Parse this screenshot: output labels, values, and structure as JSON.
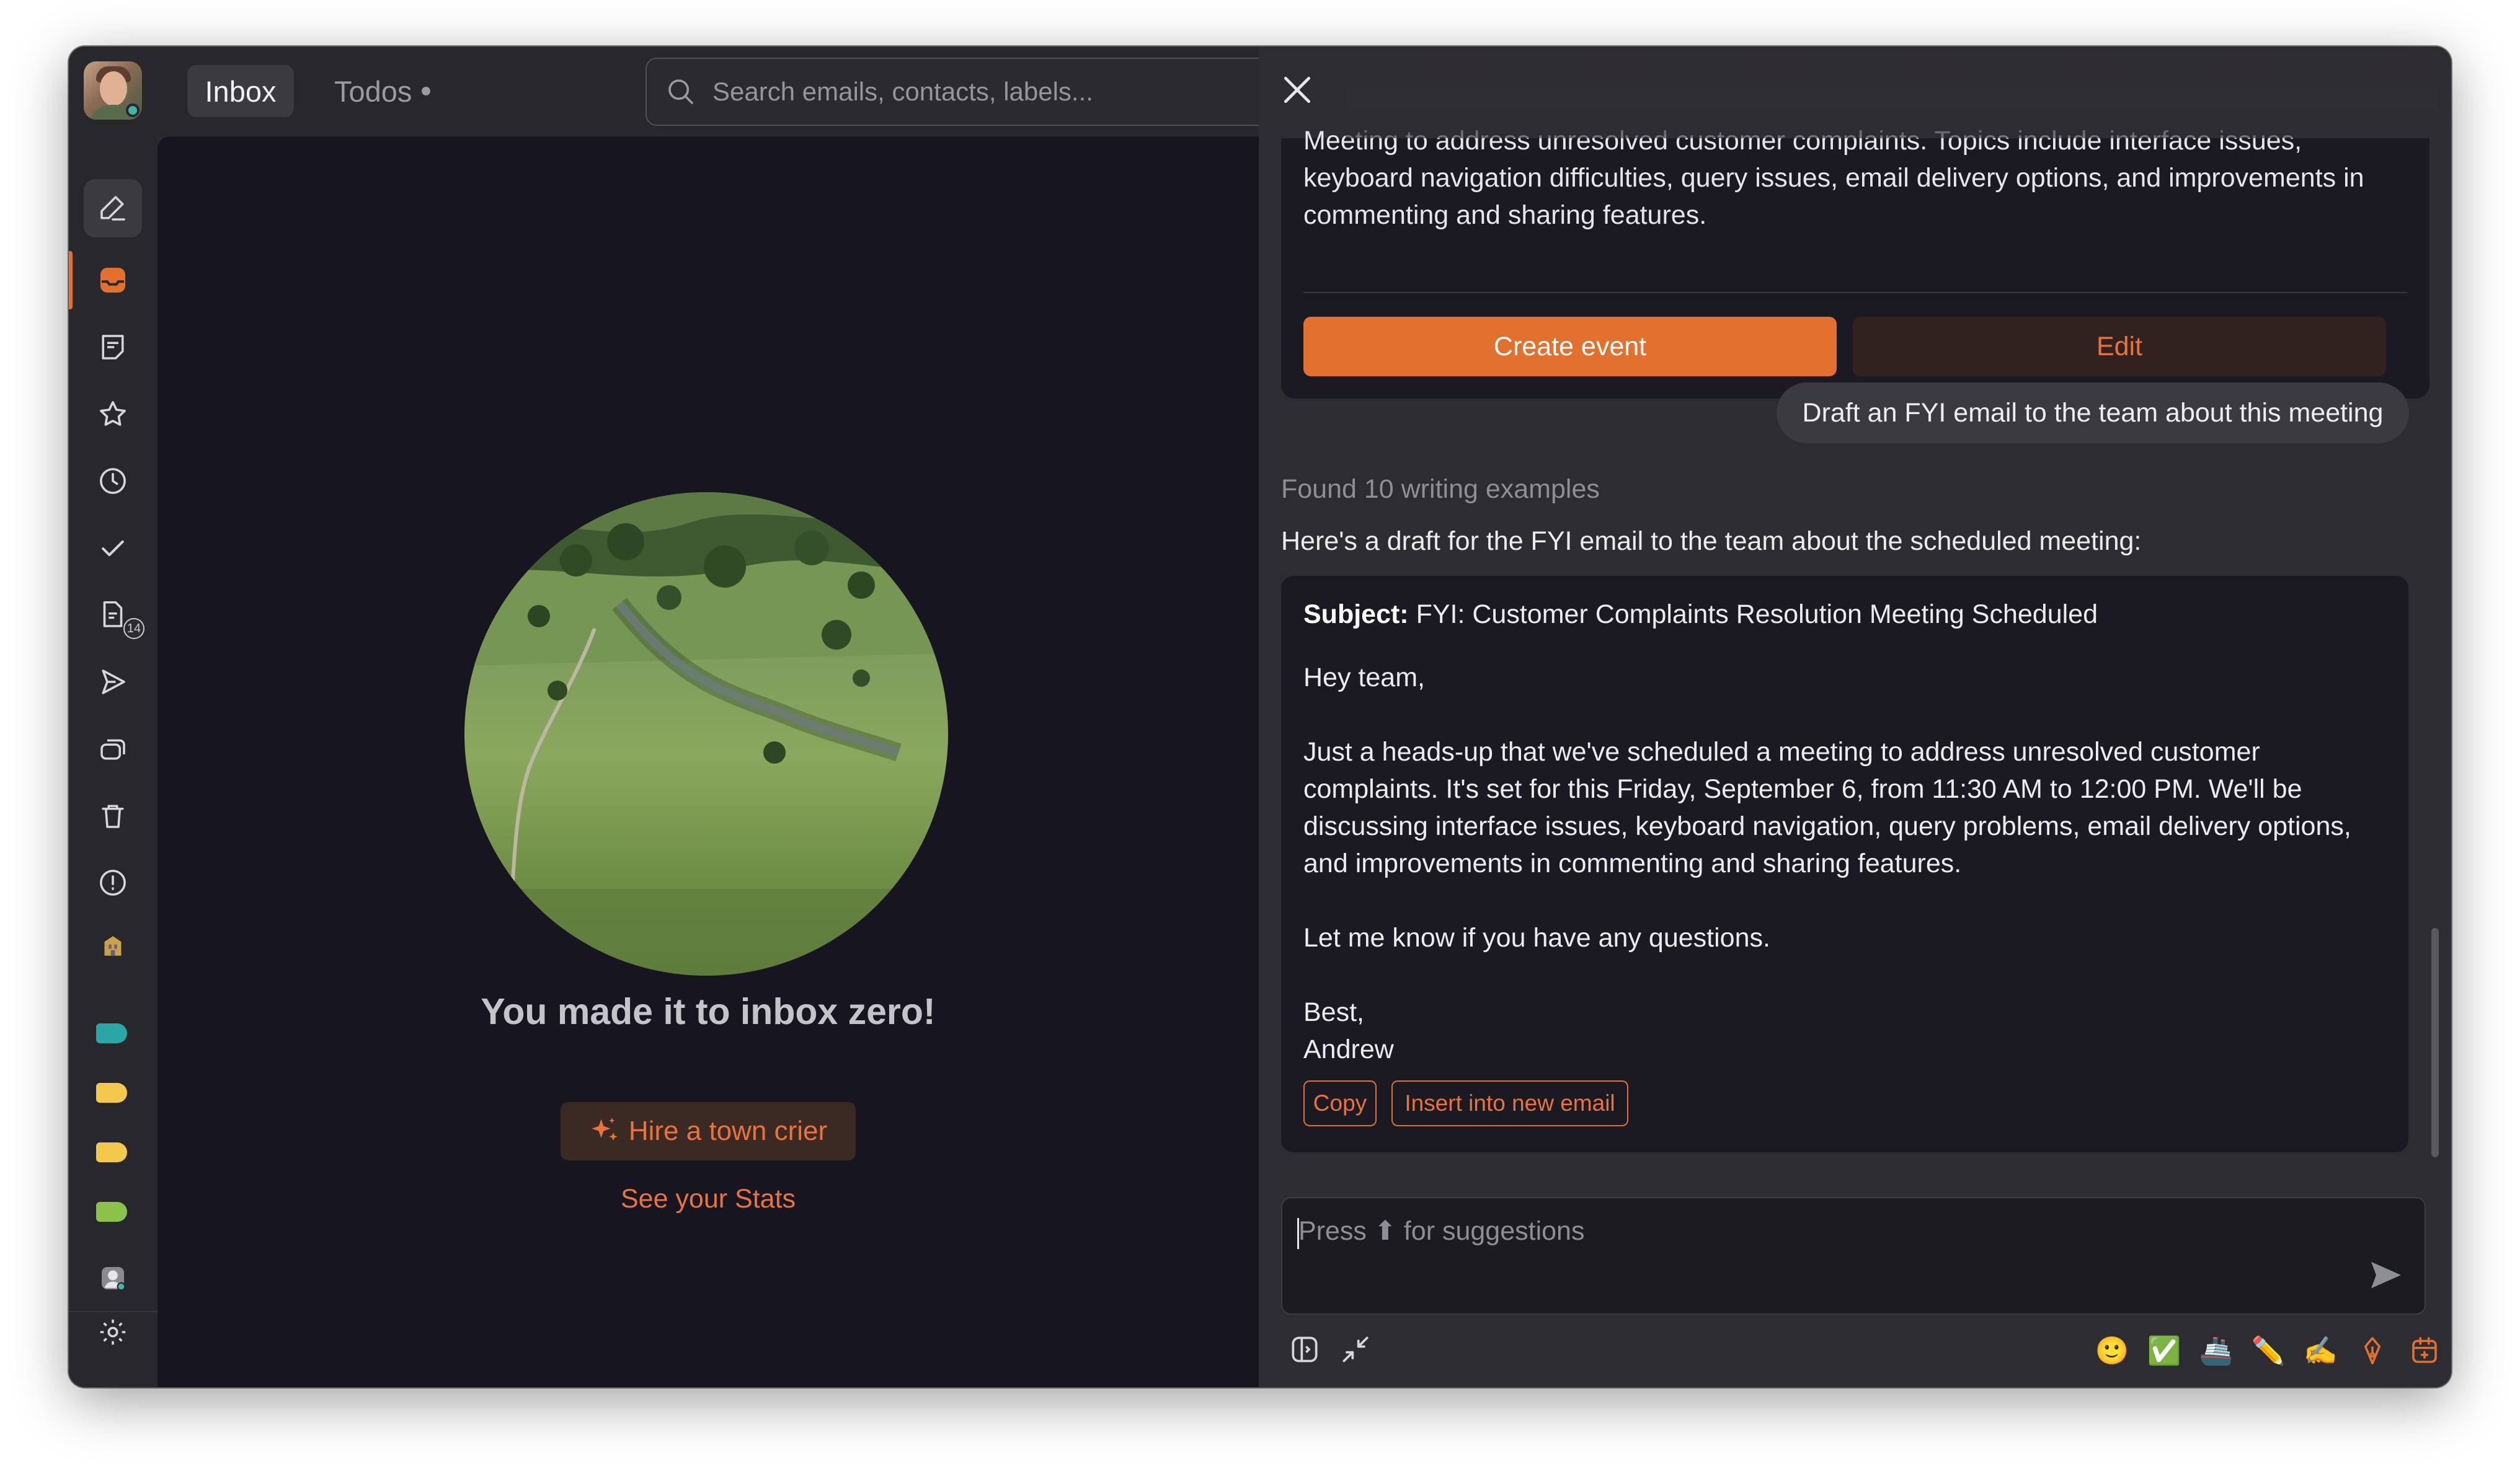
{
  "topbar": {
    "tab_inbox": "Inbox",
    "tab_todos": "Todos",
    "search_placeholder": "Search emails, contacts, labels..."
  },
  "sidebar": {
    "items": [
      {
        "name": "compose",
        "icon": "compose-icon"
      },
      {
        "name": "inbox",
        "icon": "inbox-icon",
        "active": true
      },
      {
        "name": "drafts",
        "icon": "note-icon"
      },
      {
        "name": "starred",
        "icon": "star-icon"
      },
      {
        "name": "snoozed",
        "icon": "clock-icon"
      },
      {
        "name": "done",
        "icon": "check-icon"
      },
      {
        "name": "scheduled",
        "icon": "document-icon",
        "badge": "14"
      },
      {
        "name": "sent",
        "icon": "send-icon"
      },
      {
        "name": "all-mail",
        "icon": "stack-icon"
      },
      {
        "name": "trash",
        "icon": "trash-icon"
      },
      {
        "name": "spam",
        "icon": "alert-icon"
      },
      {
        "name": "split",
        "icon": "building-icon"
      }
    ],
    "labels": [
      "#2aa6a6",
      "#f2c94c",
      "#f2c94c",
      "#8bc34a"
    ],
    "badge_count": "14"
  },
  "main": {
    "headline": "You made it to inbox zero!",
    "hire_button": "Hire a town crier",
    "stats_link": "See your Stats"
  },
  "assistant": {
    "event_description": "Meeting to address unresolved customer complaints. Topics include interface issues, keyboard navigation difficulties, query issues, email delivery options, and improvements in commenting and sharing features.",
    "create_event_label": "Create event",
    "edit_label": "Edit",
    "user_message": "Draft an FYI email to the team about this meeting",
    "found_text": "Found 10 writing examples",
    "intro_text": "Here's a draft for the FYI email to the team about the scheduled meeting:",
    "draft": {
      "subject_label": "Subject:",
      "subject": "FYI: Customer Complaints Resolution Meeting Scheduled",
      "body": "Hey team,\n\nJust a heads-up that we've scheduled a meeting to address unresolved customer complaints. It's set for this Friday, September 6, from 11:30 AM to 12:00 PM. We'll be discussing interface issues, keyboard navigation, query problems, email delivery options, and improvements in commenting and sharing features.\n\nLet me know if you have any questions.\n\nBest,\nAndrew"
    },
    "copy_label": "Copy",
    "insert_label": "Insert into new email",
    "composer_placeholder": "Press ⬆ for suggestions",
    "toolbar_emojis": [
      "🙂",
      "✅",
      "🚢",
      "✏️",
      "✍️"
    ]
  },
  "colors": {
    "accent": "#e2702e",
    "background": "#17151f",
    "panel": "#2d2c31"
  }
}
